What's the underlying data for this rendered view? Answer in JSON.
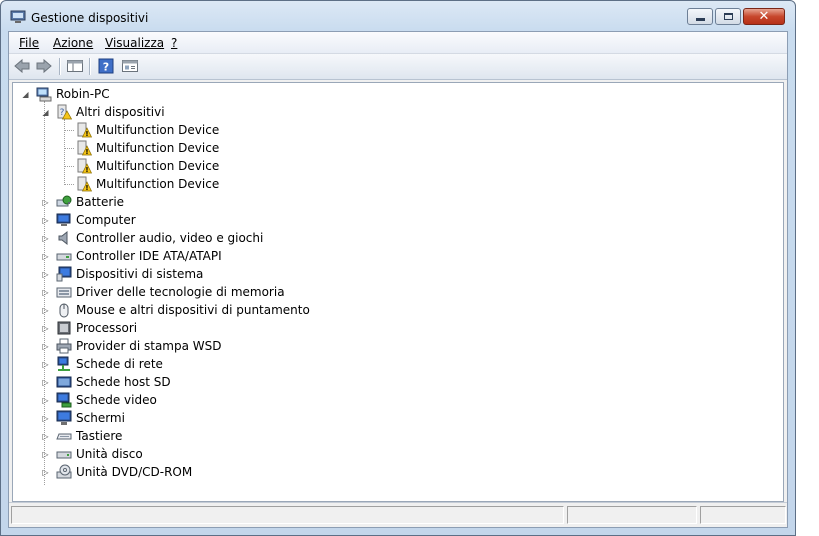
{
  "window": {
    "title": "Gestione dispositivi"
  },
  "menu": [
    {
      "label": "File",
      "access": "F"
    },
    {
      "label": "Azione",
      "access": "A"
    },
    {
      "label": "Visualizza",
      "access": "V"
    },
    {
      "label": "?",
      "access": "?"
    }
  ],
  "toolbar": [
    "back-icon",
    "forward-icon",
    "show-hide-console-tree-icon",
    "help-icon",
    "properties-icon"
  ],
  "tree": {
    "root": {
      "label": "Robin-PC",
      "icon": "computer-icon"
    },
    "other_devices": {
      "label": "Altri dispositivi",
      "children": [
        "Multifunction Device",
        "Multifunction Device",
        "Multifunction Device",
        "Multifunction Device"
      ]
    },
    "categories": [
      {
        "label": "Batterie",
        "icon": "battery-icon"
      },
      {
        "label": "Computer",
        "icon": "computer-monitor-icon"
      },
      {
        "label": "Controller audio, video e giochi",
        "icon": "speaker-icon"
      },
      {
        "label": "Controller IDE ATA/ATAPI",
        "icon": "ide-controller-icon"
      },
      {
        "label": "Dispositivi di sistema",
        "icon": "system-device-icon"
      },
      {
        "label": "Driver delle tecnologie di memoria",
        "icon": "memory-technology-icon"
      },
      {
        "label": "Mouse e altri dispositivi di puntamento",
        "icon": "mouse-icon"
      },
      {
        "label": "Processori",
        "icon": "processor-icon"
      },
      {
        "label": "Provider di stampa WSD",
        "icon": "printer-icon"
      },
      {
        "label": "Schede di rete",
        "icon": "network-adapter-icon"
      },
      {
        "label": "Schede host SD",
        "icon": "sd-host-icon"
      },
      {
        "label": "Schede video",
        "icon": "display-adapter-icon"
      },
      {
        "label": "Schermi",
        "icon": "monitor-icon"
      },
      {
        "label": "Tastiere",
        "icon": "keyboard-icon"
      },
      {
        "label": "Unità disco",
        "icon": "disk-drive-icon"
      },
      {
        "label": "Unità DVD/CD-ROM",
        "icon": "dvd-drive-icon"
      }
    ]
  },
  "colors": {
    "warning": "#f5c518",
    "title_bar": "#c9dcef",
    "close_button": "#c7472d"
  }
}
